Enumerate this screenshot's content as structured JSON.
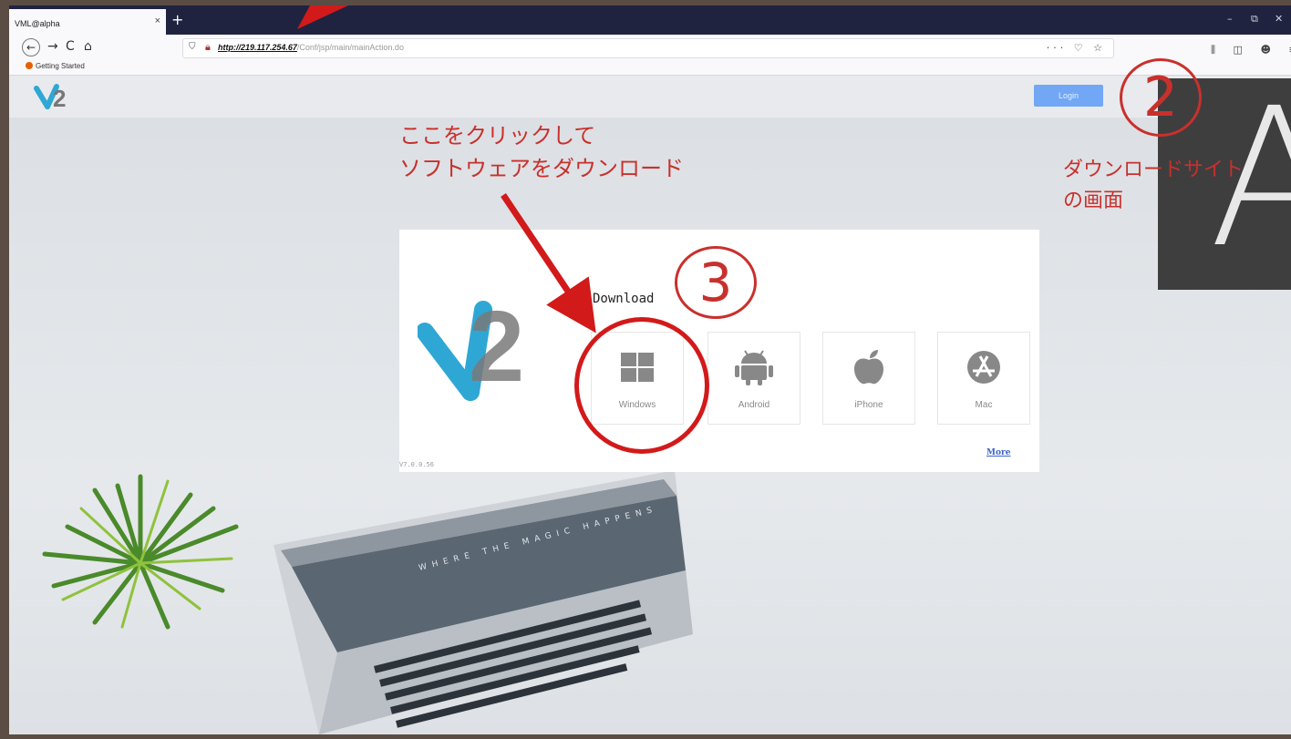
{
  "browser": {
    "tab_title": "VML@alpha",
    "tab_close": "×",
    "new_tab": "+",
    "window_controls": [
      "–",
      "⧉",
      "✕"
    ],
    "nav_back": "←",
    "nav_forward": "→",
    "nav_reload": "C",
    "nav_home": "⌂",
    "url_host": "http://219.117.254.67",
    "url_path": "/Conf/jsp/main/mainAction.do",
    "url_actions": "··· ♡ ☆",
    "toolbar_right": "⫼ ◫ ☻ ≡",
    "bookmark": "Getting Started"
  },
  "header": {
    "login_label": "Login"
  },
  "card": {
    "title": "Download",
    "platforms": [
      {
        "label": "Windows"
      },
      {
        "label": "Android"
      },
      {
        "label": "iPhone"
      },
      {
        "label": "Mac"
      }
    ],
    "version": "V7.0.0.56",
    "more_label": "More"
  },
  "annotations": {
    "instruction_line1": "ここをクリックして",
    "instruction_line2": "ソフトウェアをダウンロード",
    "step2": "②",
    "step3": "③",
    "site_label_line1": "ダウンロードサイト",
    "site_label_line2": "の画面",
    "panel_letter": "A"
  },
  "colors": {
    "annotation_red": "#c9302c",
    "login_button": "#71a7f5",
    "tabbar": "#202340"
  }
}
